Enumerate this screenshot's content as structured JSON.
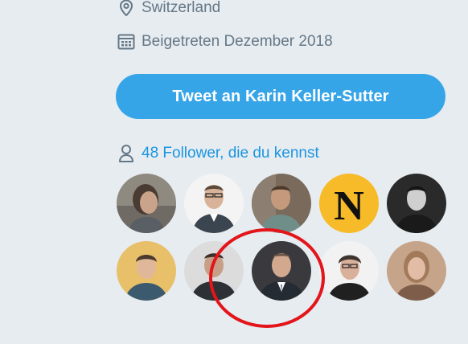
{
  "profile": {
    "location": "Switzerland",
    "joined": "Beigetreten Dezember 2018"
  },
  "tweet_button": {
    "label": "Tweet an Karin Keller-Sutter"
  },
  "followers_you_know": {
    "label": "48 Follower, die du kennst",
    "icon": "person-icon"
  },
  "avatar_row_1": [
    "follower-1",
    "follower-2",
    "follower-3",
    "follower-4",
    "follower-5"
  ],
  "avatar_row_2": [
    "follower-6",
    "follower-7",
    "follower-8",
    "follower-9",
    "follower-10"
  ],
  "colors": {
    "background": "#e6ecf0",
    "accent": "#1b95e0",
    "button": "#36a5e8",
    "secondary_text": "#657786",
    "highlight": "#e3151a"
  }
}
